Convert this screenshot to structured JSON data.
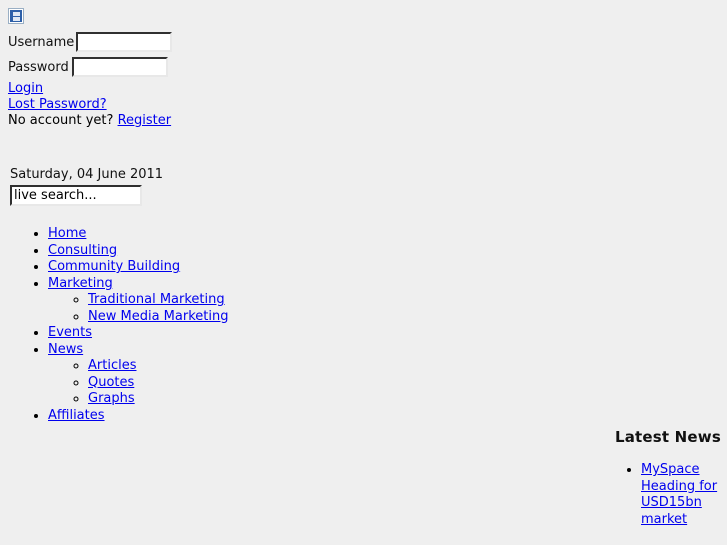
{
  "login": {
    "logo_icon": "broken-image-icon",
    "username_label": "Username",
    "username_value": "",
    "password_label": "Password",
    "password_value": "",
    "login_link": "Login",
    "lost_password_link": "Lost Password?",
    "no_account_text": "No account yet?",
    "register_link": "Register"
  },
  "date": "Saturday, 04 June 2011",
  "search": {
    "value": "live search...",
    "placeholder": "live search..."
  },
  "menu": {
    "items": [
      {
        "label": "Home",
        "children": []
      },
      {
        "label": "Consulting",
        "children": []
      },
      {
        "label": "Community Building",
        "children": []
      },
      {
        "label": "Marketing",
        "children": [
          {
            "label": "Traditional Marketing"
          },
          {
            "label": "New Media Marketing"
          }
        ]
      },
      {
        "label": "Events",
        "children": []
      },
      {
        "label": "News",
        "children": [
          {
            "label": "Articles"
          },
          {
            "label": "Quotes"
          },
          {
            "label": "Graphs"
          }
        ]
      },
      {
        "label": "Affiliates",
        "children": []
      }
    ]
  },
  "latest_news": {
    "heading": "Latest News",
    "items": [
      {
        "label": "MySpace Heading for USD15bn market"
      }
    ]
  },
  "colors": {
    "background": "#efefef",
    "link": "#0000ee",
    "text": "#000000"
  }
}
